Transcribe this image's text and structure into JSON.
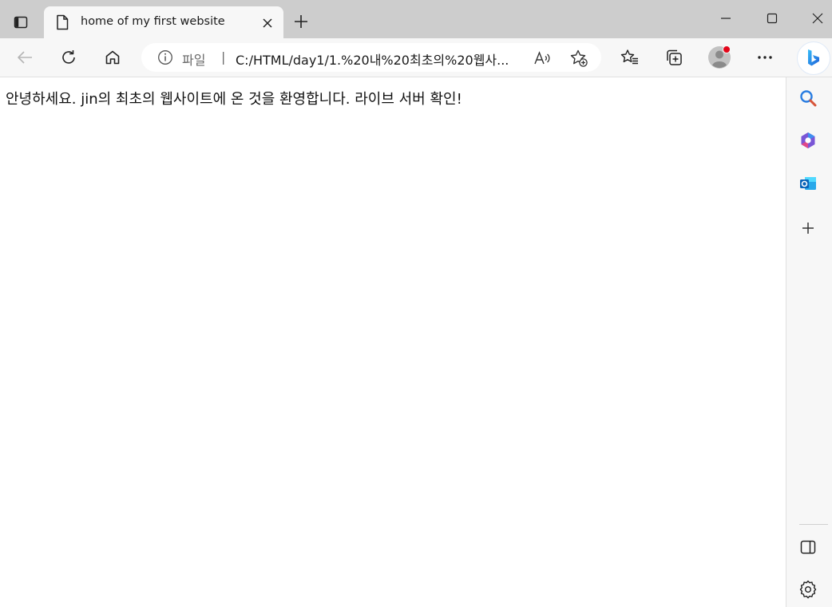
{
  "tab": {
    "title": "home of my first website"
  },
  "address_bar": {
    "scheme_label": "파일",
    "separator": "|",
    "url": "C:/HTML/day1/1.%20내%20최초의%20웹사..."
  },
  "page": {
    "text": "안녕하세요. jin의 최초의 웹사이트에 온 것을 환영합니다. 라이브 서버 확인!"
  },
  "icons": {
    "tab_actions": "tab-actions-icon",
    "tab_page": "document-icon",
    "tab_close": "close-icon",
    "new_tab": "plus-icon",
    "minimize": "minimize-icon",
    "maximize": "maximize-icon",
    "close_window": "close-icon",
    "back": "back-arrow-icon",
    "refresh": "refresh-icon",
    "home": "home-icon",
    "site_info": "info-icon",
    "read_aloud": "read-aloud-icon",
    "add_favorite": "star-add-icon",
    "favorites": "favorites-icon",
    "collections": "collections-icon",
    "profile": "avatar-icon",
    "more": "more-icon",
    "bing": "bing-icon",
    "sidebar_search": "search-icon",
    "sidebar_office": "office-icon",
    "sidebar_outlook": "outlook-icon",
    "sidebar_add": "plus-icon",
    "sidebar_toggle": "sidebar-toggle-icon",
    "settings": "gear-icon"
  },
  "colors": {
    "tabstrip": "#cdcdcd",
    "toolbar": "#f7f7f7",
    "profile_badge": "#e3061a",
    "bing_accent": "#1e8be6"
  }
}
